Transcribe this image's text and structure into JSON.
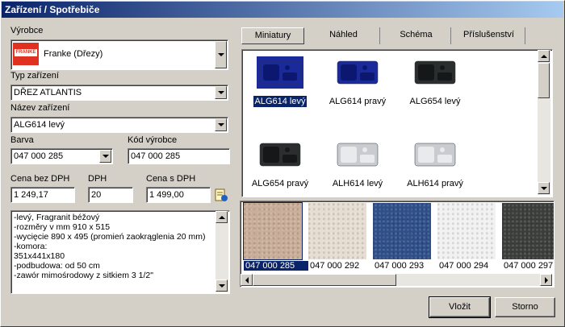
{
  "window": {
    "title": "Zařízení / Spotřebiče"
  },
  "form": {
    "manufacturer_label": "Výrobce",
    "manufacturer_value": "Franke (Dřezy)",
    "manufacturer_logo_text": "FRANKE",
    "device_type_label": "Typ zařízení",
    "device_type_value": "DŘEZ ATLANTIS",
    "device_name_label": "Název zařízení",
    "device_name_value": "ALG614 levý",
    "color_label": "Barva",
    "color_value": "047 000 285",
    "mfr_code_label": "Kód výrobce",
    "mfr_code_value": "047 000 285",
    "price_no_vat_label": "Cena bez DPH",
    "price_no_vat_value": "1 249,17",
    "vat_label": "DPH",
    "vat_value": "20",
    "price_vat_label": "Cena s DPH",
    "price_vat_value": "1 499,00",
    "notes": [
      "-levý, Fragranit béžový",
      "-rozměry v mm 910 x 515",
      "-wycięcie 890 x 495 (promień zaokrąglenia 20 mm)",
      "-komora:",
      " 351x441x180",
      "-podbudowa: od 50 cm",
      "-zawór mimośrodowy z sitkiem 3 1/2\""
    ]
  },
  "tabs": [
    "Miniatury",
    "Náhled",
    "Schéma",
    "Příslušenství"
  ],
  "thumbnails": [
    {
      "label": "ALG614 levý",
      "selected": true,
      "kind": "blue"
    },
    {
      "label": "ALG614 pravý",
      "selected": false,
      "kind": "blue"
    },
    {
      "label": "ALG654 levý",
      "selected": false,
      "kind": "black"
    },
    {
      "label": "ALG654 pravý",
      "selected": false,
      "kind": "black"
    },
    {
      "label": "ALH614 levý",
      "selected": false,
      "kind": "steel"
    },
    {
      "label": "ALH614 pravý",
      "selected": false,
      "kind": "steel"
    }
  ],
  "colors": [
    {
      "code": "047 000 285",
      "selected": true,
      "hex": "#c9ad98"
    },
    {
      "code": "047 000 292",
      "selected": false,
      "hex": "#e6ddd2"
    },
    {
      "code": "047 000 293",
      "selected": false,
      "hex": "#2e4f8a"
    },
    {
      "code": "047 000 294",
      "selected": false,
      "hex": "#f1f1f1"
    },
    {
      "code": "047 000 297",
      "selected": false,
      "hex": "#3b3d3b"
    }
  ],
  "buttons": {
    "insert": "Vložit",
    "cancel": "Storno"
  }
}
